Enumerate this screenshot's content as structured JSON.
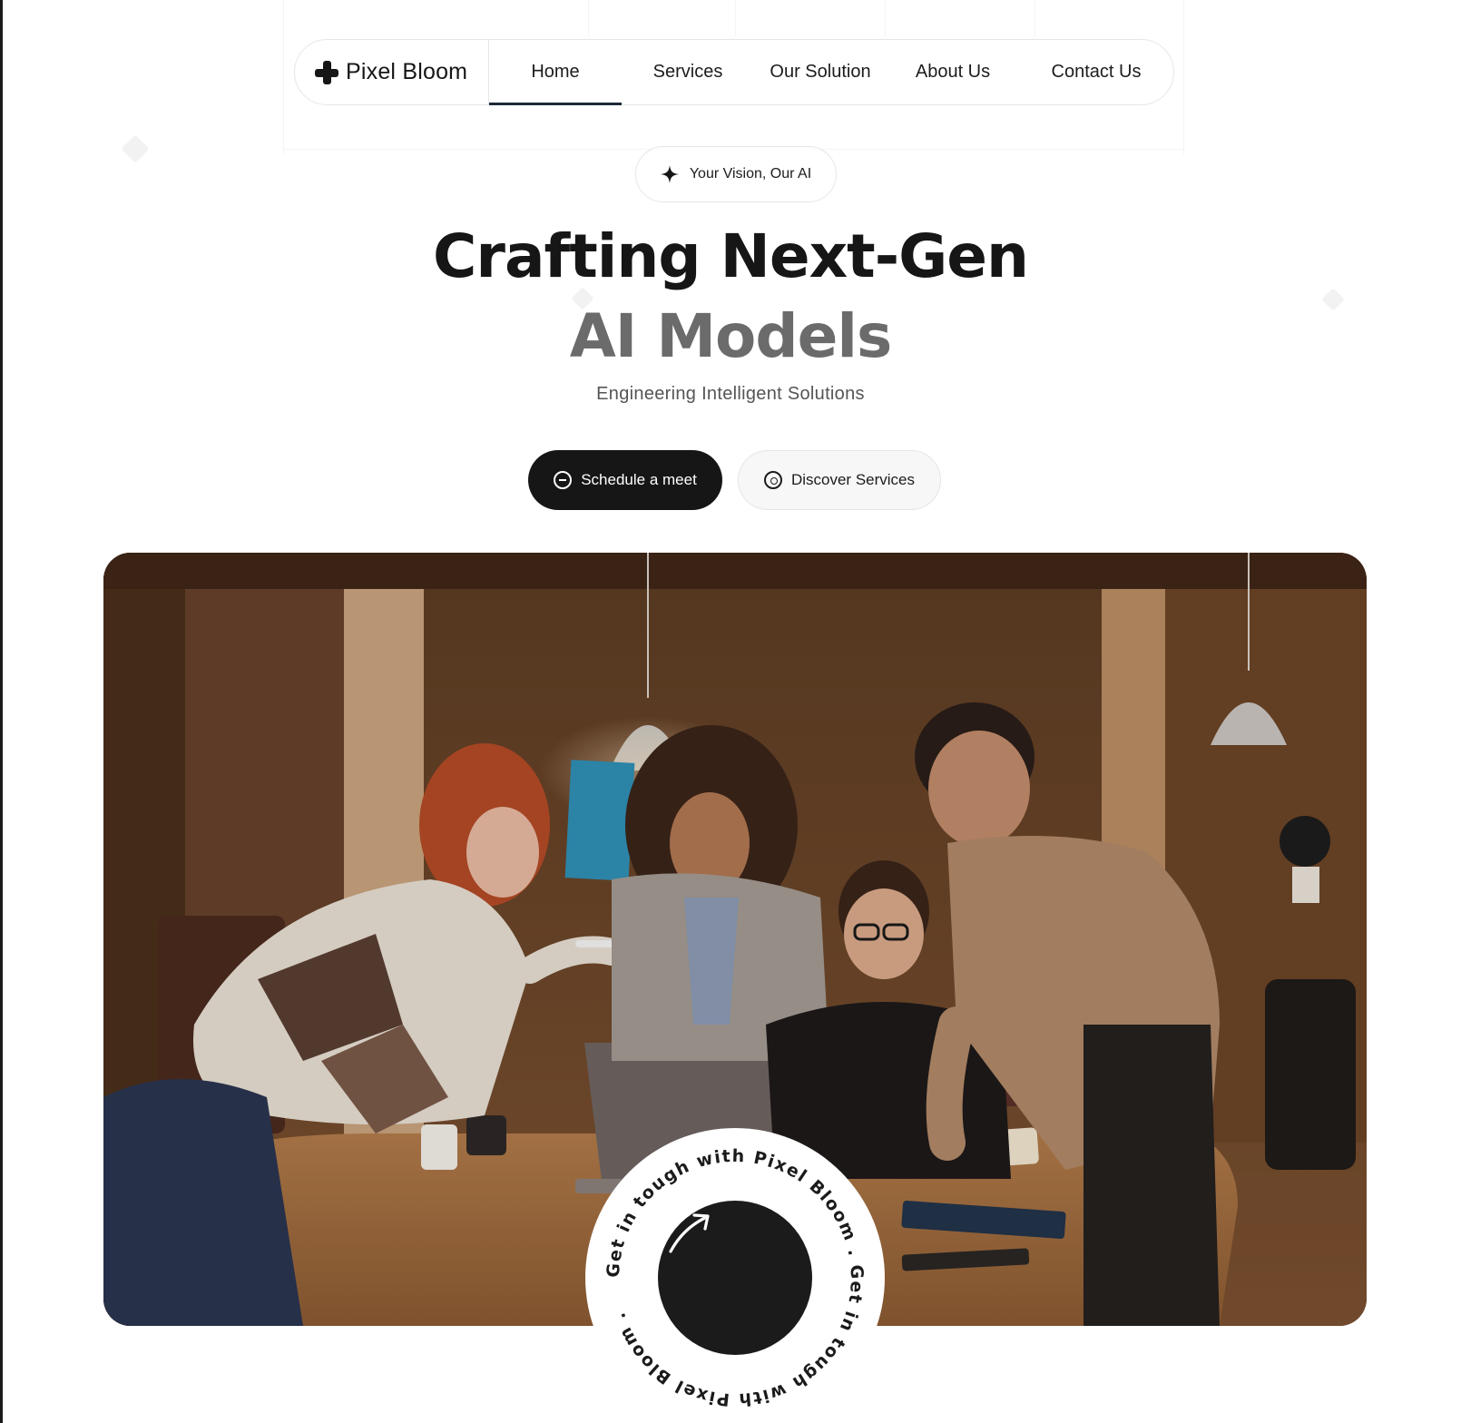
{
  "brand": {
    "name": "Pixel Bloom",
    "icon": "plus-icon"
  },
  "nav": {
    "items": [
      {
        "label": "Home",
        "active": true
      },
      {
        "label": "Services",
        "active": false
      },
      {
        "label": "Our Solution",
        "active": false
      },
      {
        "label": "About Us",
        "active": false
      },
      {
        "label": "Contact Us",
        "active": false
      }
    ]
  },
  "badge": {
    "icon": "sparkle-icon",
    "text": "Your Vision, Our AI"
  },
  "hero": {
    "title_line1": "Crafting Next-Gen",
    "title_line2": "AI Models",
    "subtitle": "Engineering Intelligent Solutions",
    "primary_cta": {
      "label": "Schedule a meet",
      "icon": "minus-circle-icon"
    },
    "secondary_cta": {
      "label": "Discover Services",
      "icon": "compass-icon"
    },
    "image_alt": "Team of four colleagues collaborating around a laptop in a wood-paneled office"
  },
  "stamp": {
    "text": "Get in tough with Pixel Bloom .  Get in tough with Pixel Bloom .",
    "icon": "arrow-up-right-icon"
  },
  "colors": {
    "accent": "#161616",
    "muted_heading": "#6b6b6b",
    "nav_underline": "#1e2a3a",
    "border": "#e6e6e6"
  }
}
